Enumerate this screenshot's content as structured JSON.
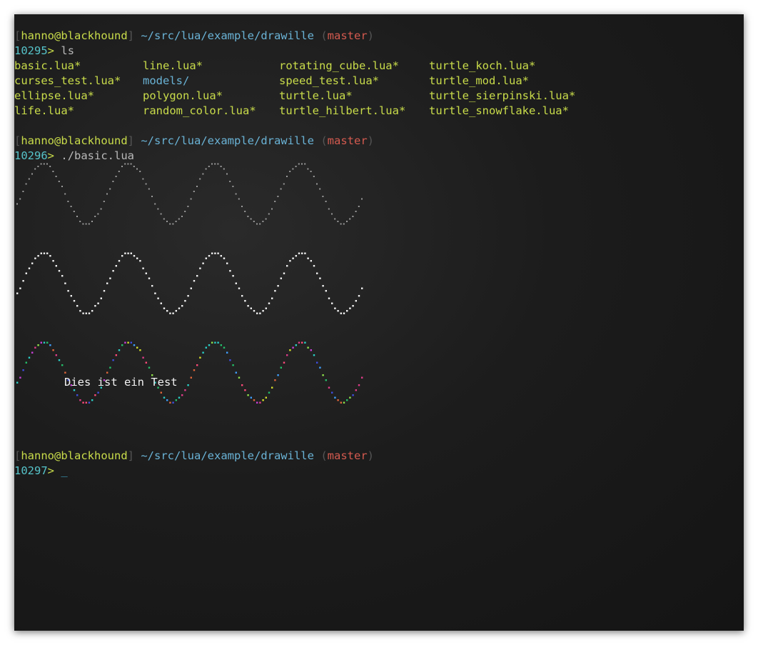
{
  "prompt": {
    "open_bracket": "[",
    "user_host": "hanno@blackhound",
    "close_bracket": "]",
    "path": "~/src/lua/example/drawille",
    "branch_open": "(",
    "branch": "master",
    "branch_close": ")",
    "gt": ">"
  },
  "blocks": [
    {
      "number": "10295",
      "command": "ls"
    },
    {
      "number": "10296",
      "command": "./basic.lua"
    },
    {
      "number": "10297",
      "cursor": "_"
    }
  ],
  "files": [
    {
      "name": "basic.lua",
      "mark": "*",
      "kind": "exe"
    },
    {
      "name": "line.lua",
      "mark": "*",
      "kind": "exe"
    },
    {
      "name": "rotating_cube.lua",
      "mark": "*",
      "kind": "exe"
    },
    {
      "name": "turtle_koch.lua",
      "mark": "*",
      "kind": "exe"
    },
    {
      "name": "curses_test.lua",
      "mark": "*",
      "kind": "exe"
    },
    {
      "name": "models",
      "mark": "/",
      "kind": "dir"
    },
    {
      "name": "speed_test.lua",
      "mark": "*",
      "kind": "exe"
    },
    {
      "name": "turtle_mod.lua",
      "mark": "*",
      "kind": "exe"
    },
    {
      "name": "ellipse.lua",
      "mark": "*",
      "kind": "exe"
    },
    {
      "name": "polygon.lua",
      "mark": "*",
      "kind": "exe"
    },
    {
      "name": "turtle.lua",
      "mark": "*",
      "kind": "exe"
    },
    {
      "name": "turtle_sierpinski.lua",
      "mark": "*",
      "kind": "exe"
    },
    {
      "name": "life.lua",
      "mark": "*",
      "kind": "exe"
    },
    {
      "name": "random_color.lua",
      "mark": "*",
      "kind": "exe"
    },
    {
      "name": "turtle_hilbert.lua",
      "mark": "*",
      "kind": "exe"
    },
    {
      "name": "turtle_snowflake.lua",
      "mark": "*",
      "kind": "exe"
    }
  ],
  "canvas_text": "Dies ist ein Test",
  "colors": {
    "background": "#1c1c1c",
    "user": "#c9dc4a",
    "path": "#6ab3d6",
    "branch": "#d45a4f",
    "number": "#56c3c9",
    "bracket": "#555555",
    "executable": "#c9dc4a",
    "directory": "#6ab3d6",
    "wave_gray": "#9a9a9a",
    "wave_white": "#f0f0f0",
    "wave_random_palette": [
      "#e23c8a",
      "#3f4fe0",
      "#24c06a",
      "#d4e02a",
      "#2ad0c8",
      "#c940d8",
      "#e0663a",
      "#3fa0ff",
      "#8fe24a",
      "#ff4a7a"
    ]
  }
}
